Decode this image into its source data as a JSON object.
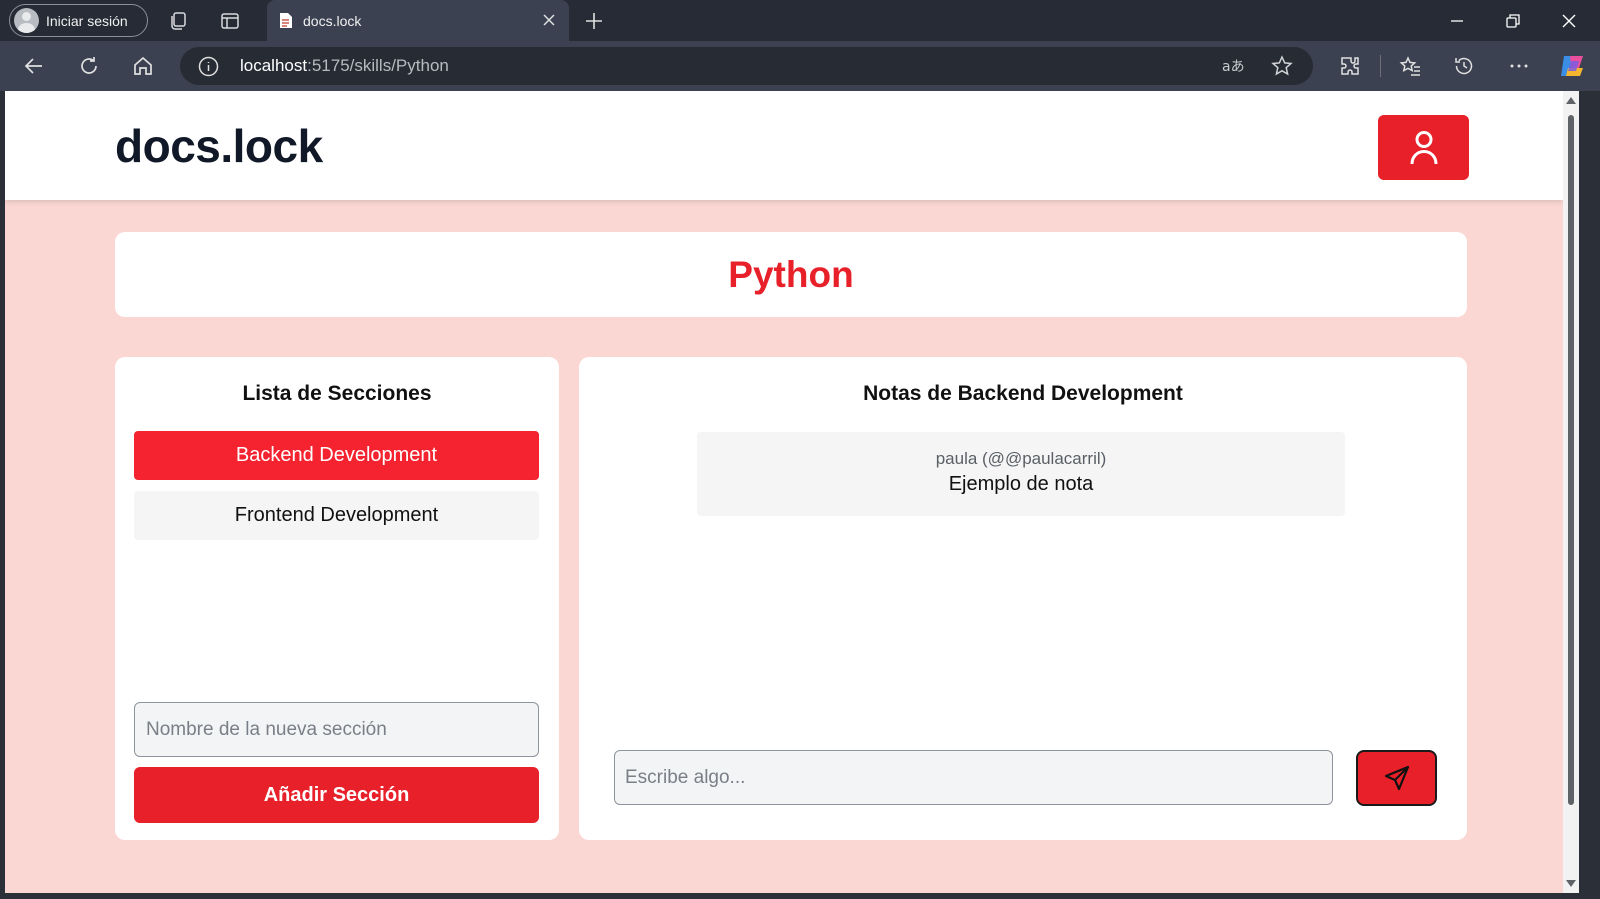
{
  "browser": {
    "profile_label": "Iniciar sesión",
    "tab_title": "docs.lock",
    "url_host": "localhost",
    "url_rest": ":5175/skills/Python"
  },
  "header": {
    "brand": "docs.lock"
  },
  "skill": {
    "title": "Python"
  },
  "sections": {
    "heading": "Lista de Secciones",
    "items": [
      {
        "label": "Backend Development",
        "active": true
      },
      {
        "label": "Frontend Development",
        "active": false
      }
    ],
    "new_section_placeholder": "Nombre de la nueva sección",
    "add_button_label": "Añadir Sección"
  },
  "notes": {
    "heading": "Notas de Backend Development",
    "items": [
      {
        "author": "paula (@@paulacarril)",
        "text": "Ejemplo de nota"
      }
    ],
    "input_placeholder": "Escribe algo..."
  },
  "colors": {
    "accent": "#e8202a",
    "page_background": "#fad7d2",
    "browser_frame": "#262b35"
  },
  "icons": {
    "user_button": "user-icon",
    "send_button": "send-icon"
  }
}
